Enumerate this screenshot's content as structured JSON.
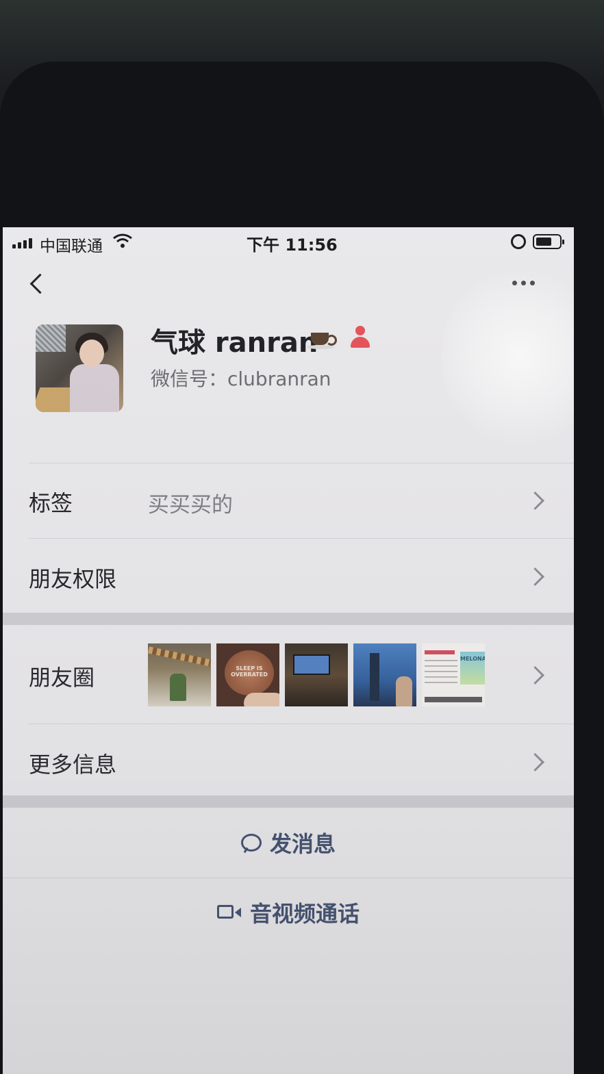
{
  "status_bar": {
    "carrier": "中国联通",
    "time": "下午 11:56"
  },
  "profile": {
    "nickname": "气球 ranran",
    "wechat_id": "微信号：clubranran"
  },
  "rows": {
    "tags_label": "标签",
    "tags_value": "买买买的",
    "permissions_label": "朋友权限",
    "moments_label": "朋友圈",
    "more_info_label": "更多信息"
  },
  "moments_thumb_text": {
    "coffee_cap": "SLEEP IS OVERRATED",
    "promo_brand": "MELONA"
  },
  "actions": {
    "send_message": "发消息",
    "av_call": "音视频通话"
  },
  "colors": {
    "accent_link": "#3b4a6b",
    "page_bg": "#e9e8ea",
    "badge_red": "#e4545a"
  }
}
